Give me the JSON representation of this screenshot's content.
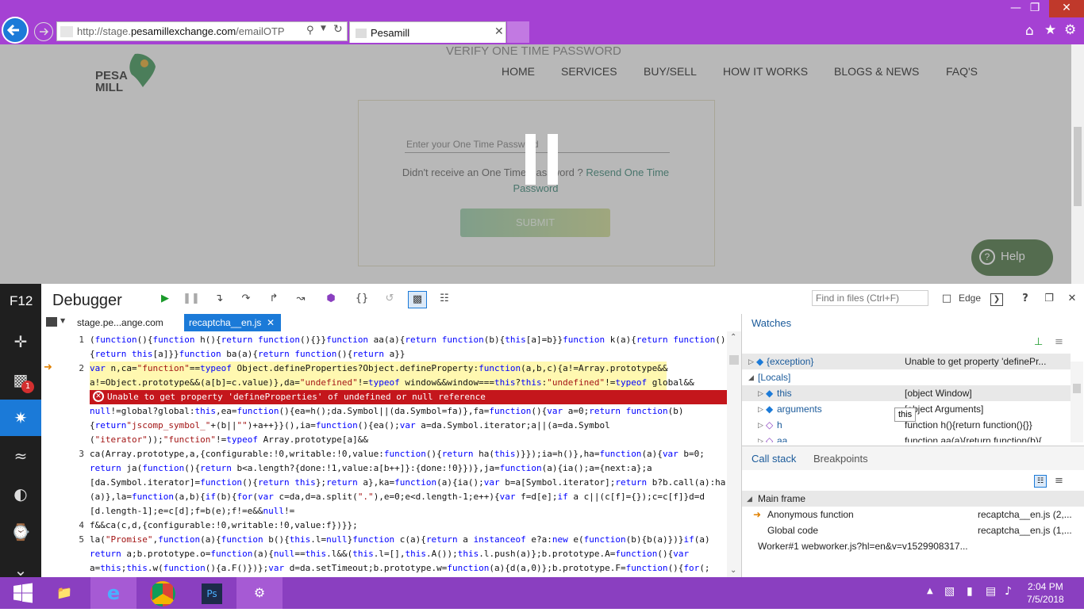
{
  "browser": {
    "url_prefix": "http://stage.",
    "url_domain": "pesamillexchange.com",
    "url_path": "/emailOTP",
    "tab_title": "Pesamill"
  },
  "site": {
    "logo_line1": "PESA",
    "logo_line2": "MILL",
    "nav": [
      "HOME",
      "SERVICES",
      "BUY/SELL",
      "HOW IT WORKS",
      "BLOGS & NEWS",
      "FAQ'S"
    ],
    "verify_title": "VERIFY ONE TIME PASSWORD",
    "otp_placeholder": "Enter your One Time Password",
    "resend_prefix": "Didn't receive an One Time Password ?",
    "resend_link": "Resend One Time Password",
    "submit_label": "SUBMIT",
    "help_label": "Help"
  },
  "devtools": {
    "f12_label": "F12",
    "title": "Debugger",
    "find_placeholder": "Find in files (Ctrl+F)",
    "browser_mode": "Edge",
    "console_badge": "1",
    "file_tabs": [
      "stage.pe...ange.com",
      "recaptcha__en.js"
    ],
    "error_message": "Unable to get property 'defineProperties' of undefined or null reference",
    "watches": {
      "title": "Watches",
      "rows": [
        {
          "name": "{exception}",
          "value": "Unable to get property 'definePr..."
        },
        {
          "name": "[Locals]",
          "value": ""
        },
        {
          "name": "this",
          "value": "[object Window]"
        },
        {
          "name": "arguments",
          "value": "[object Arguments]"
        },
        {
          "name": "h",
          "value": "function h(){return function(){}}"
        },
        {
          "name": "aa",
          "value": "function aa(a){return function(b){..."
        }
      ],
      "tooltip": "this"
    },
    "callstack": {
      "tabs": [
        "Call stack",
        "Breakpoints"
      ],
      "group": "Main frame",
      "frames": [
        {
          "name": "Anonymous function",
          "loc": "recaptcha__en.js (2,..."
        },
        {
          "name": "Global code",
          "loc": "recaptcha__en.js (1,..."
        }
      ],
      "worker": "Worker#1 webworker.js?hl=en&v=v1529908317..."
    }
  },
  "taskbar": {
    "time": "2:04 PM",
    "date": "7/5/2018"
  }
}
